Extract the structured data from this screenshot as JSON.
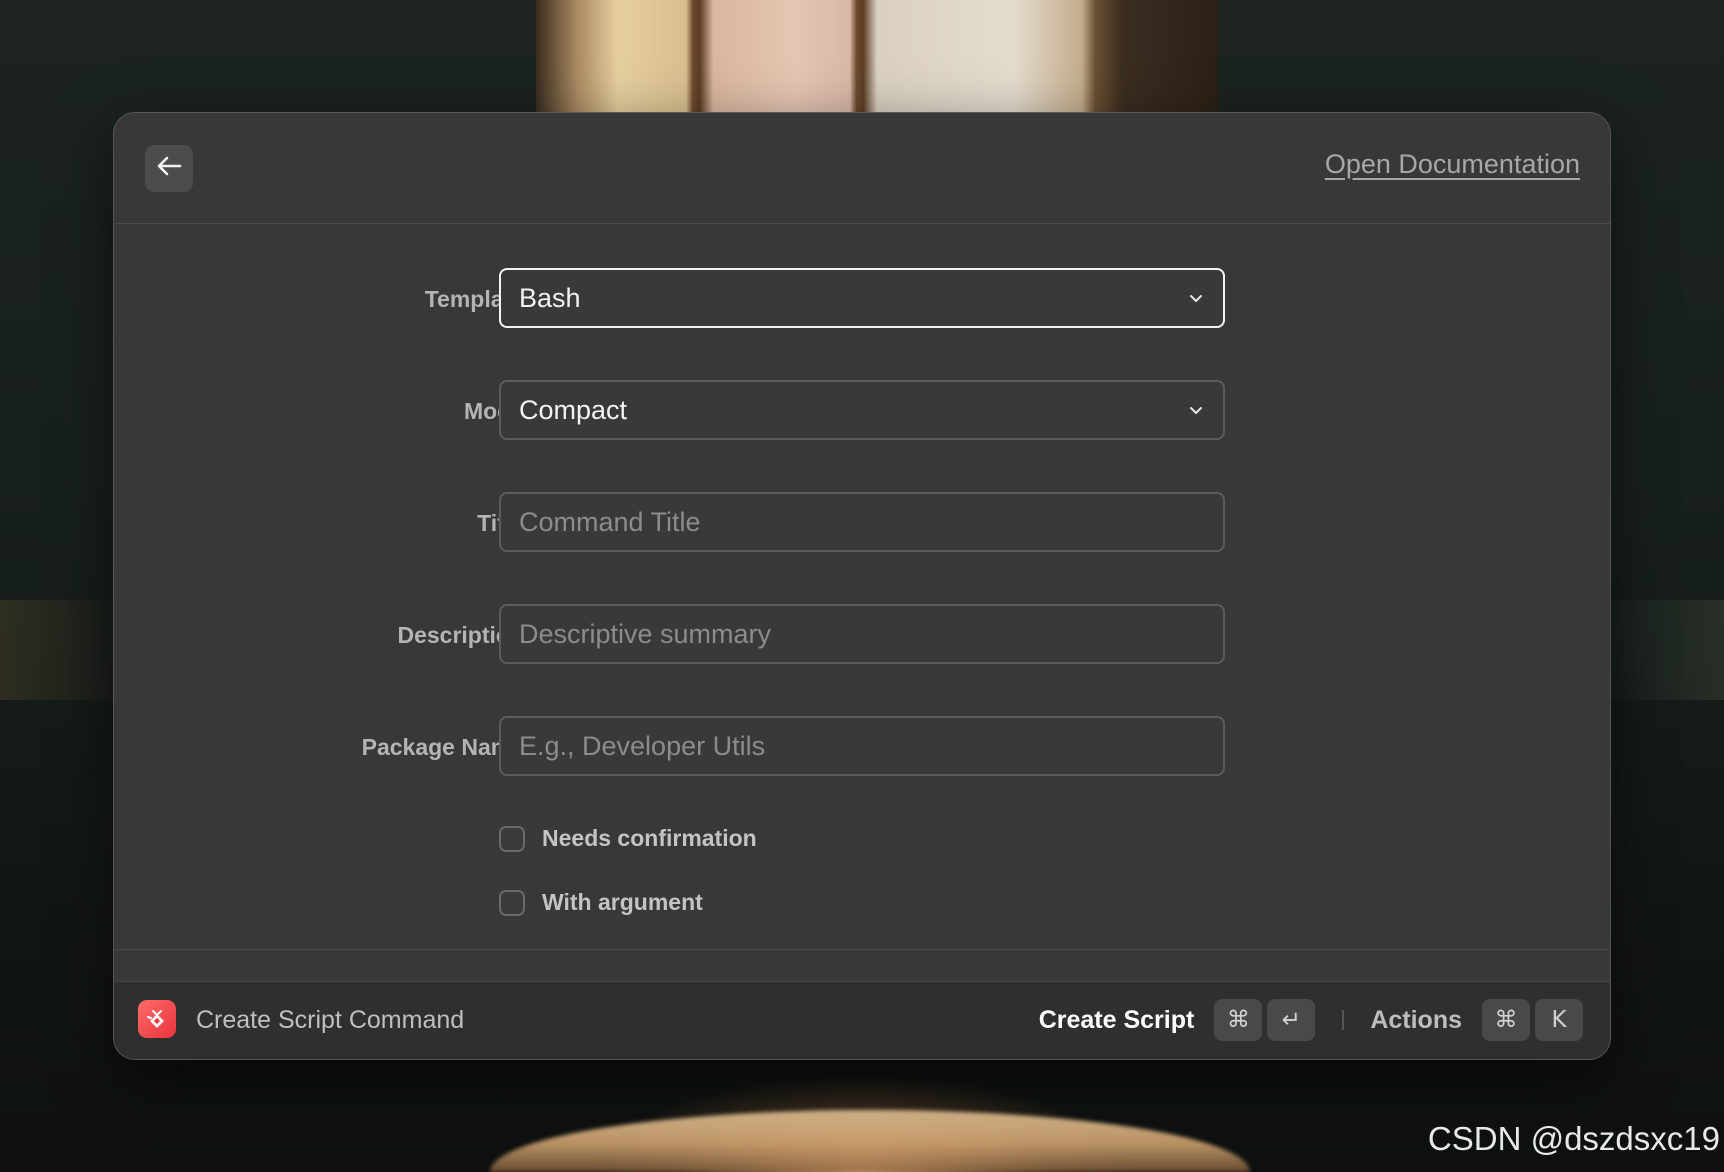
{
  "header": {
    "open_documentation": "Open Documentation"
  },
  "form": {
    "template": {
      "label": "Template",
      "value": "Bash"
    },
    "mode": {
      "label": "Mode",
      "value": "Compact"
    },
    "title": {
      "label": "Title",
      "placeholder": "Command Title",
      "value": ""
    },
    "description": {
      "label": "Description",
      "placeholder": "Descriptive summary",
      "value": ""
    },
    "package_name": {
      "label": "Package Name",
      "placeholder": "E.g., Developer Utils",
      "value": ""
    },
    "checkboxes": [
      {
        "label": "Needs confirmation",
        "checked": false
      },
      {
        "label": "With argument",
        "checked": false
      }
    ]
  },
  "footer": {
    "title": "Create Script Command",
    "primary_action": "Create Script",
    "primary_shortcut": [
      "⌘",
      "↵"
    ],
    "secondary_action": "Actions",
    "secondary_shortcut": [
      "⌘",
      "K"
    ]
  },
  "watermark": "CSDN @dszdsxc19",
  "colors": {
    "panel_bg": "#383838",
    "footer_bg": "#2f2f2f",
    "focus_border": "#f2f2f2",
    "brand_red": "#e8343b"
  }
}
